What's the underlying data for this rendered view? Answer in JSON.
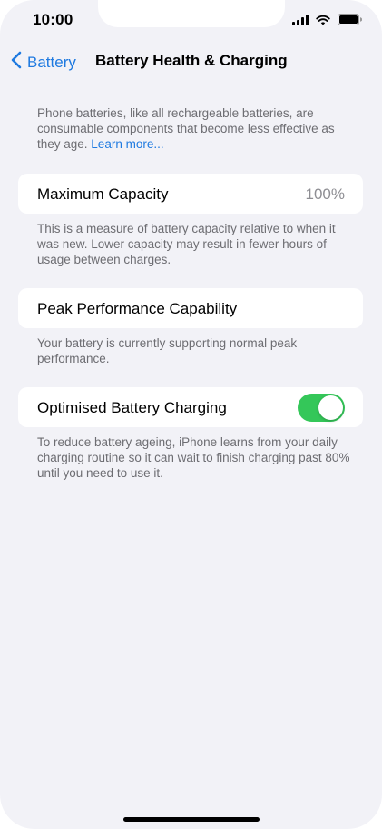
{
  "status_bar": {
    "time": "10:00"
  },
  "nav": {
    "back_label": "Battery",
    "title": "Battery Health & Charging"
  },
  "intro": {
    "text": "Phone batteries, like all rechargeable batteries, are consumable components that become less effective as they age. ",
    "link": "Learn more..."
  },
  "max_capacity": {
    "label": "Maximum Capacity",
    "value": "100%",
    "footnote": "This is a measure of battery capacity relative to when it was new. Lower capacity may result in fewer hours of usage between charges."
  },
  "peak_performance": {
    "label": "Peak Performance Capability",
    "footnote": "Your battery is currently supporting normal peak performance."
  },
  "optimised_charging": {
    "label": "Optimised Battery Charging",
    "enabled": true,
    "footnote": "To reduce battery ageing, iPhone learns from your daily charging routine so it can wait to finish charging past 80% until you need to use it."
  },
  "colors": {
    "accent": "#1f7ae0",
    "toggle_on": "#34c759",
    "background": "#f2f2f7"
  }
}
